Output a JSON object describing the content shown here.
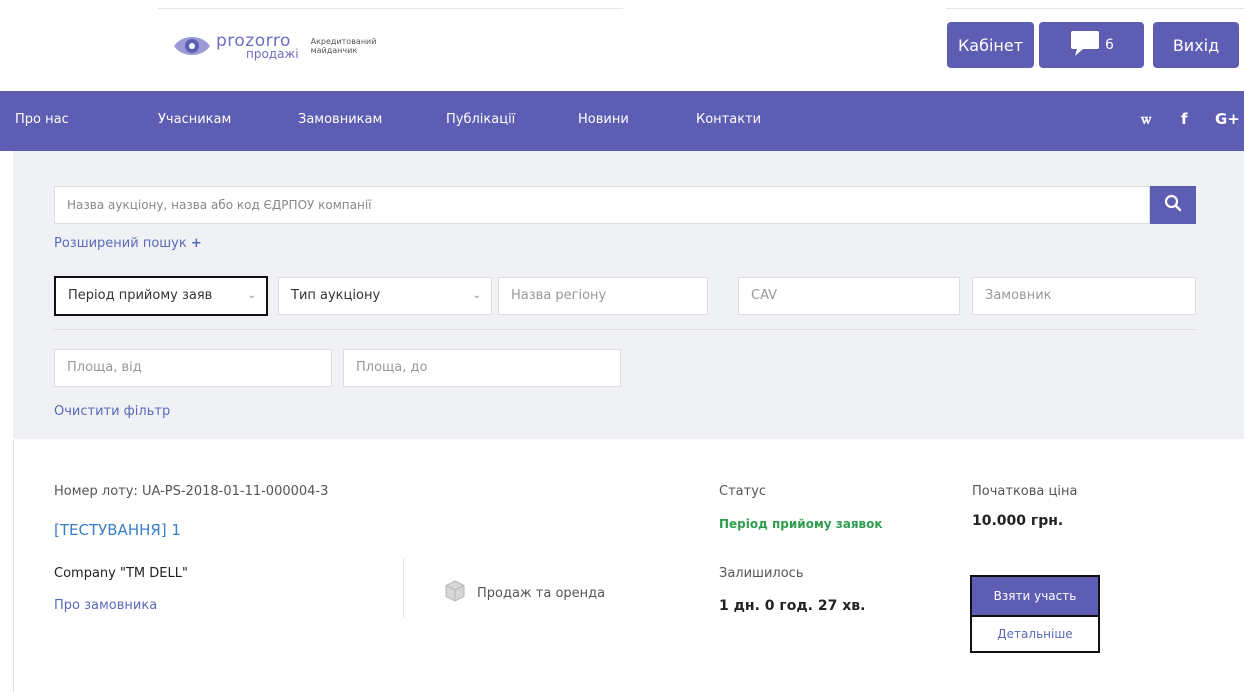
{
  "header": {
    "logo_main": "prozorro",
    "logo_sub": "продажі",
    "logo_badge": "Акредитований майданчик",
    "cabinet_label": "Кабінет",
    "messages_count": "6",
    "exit_label": "Вихід"
  },
  "nav": {
    "items": [
      "Про нас",
      "Учасникам",
      "Замовникам",
      "Публікації",
      "Новини",
      "Контакти"
    ],
    "social": [
      "vk-icon",
      "facebook-icon",
      "google-plus-icon"
    ],
    "social_labels": [
      "ꮃ",
      "f",
      "G+"
    ]
  },
  "filters": {
    "search_placeholder": "Назва аукціону, назва або код ЄДРПОУ компанії",
    "advanced_search": "Розширений пошук",
    "advanced_plus": "+",
    "period_select": "Період прийому заяв",
    "type_select": "Тип аукціону",
    "region_placeholder": "Назва регіону",
    "cav_placeholder": "CAV",
    "customer_placeholder": "Замовник",
    "area_from_placeholder": "Площа, від",
    "area_to_placeholder": "Площа, до",
    "clear_filter": "Очистити фільтр"
  },
  "lot": {
    "number_label": "Номер лоту: UA-PS-2018-01-11-000004-3",
    "title": "[ТЕСТУВАННЯ] 1",
    "company": "Company \"TM DELL\"",
    "about_customer": "Про замовника",
    "category": "Продаж та оренда",
    "status_label": "Статус",
    "status_value": "Період прийому заявок",
    "remaining_label": "Залишилось",
    "remaining_value": "1 дн. 0 год. 27 хв.",
    "price_label": "Початкова ціна",
    "price_value": "10.000 грн.",
    "participate_button": "Взяти участь",
    "details_button": "Детальніше"
  },
  "colors": {
    "brand": "#5d5db4",
    "panel": "#f0f1f5",
    "link": "#5a6ab8",
    "status_green": "#2e9e4e"
  }
}
